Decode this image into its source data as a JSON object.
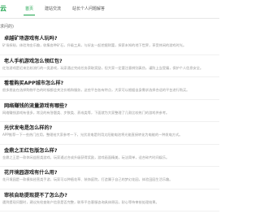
{
  "header": {
    "logo_text": "云",
    "nav": [
      "首页",
      "建站交流",
      "站长个人问题解答"
    ]
  },
  "section_title": "求问的)",
  "items": [
    {
      "title": "卓越矿场游戏有人玩吗?",
      "desc": "矿场探秘，体验淘金乐趣，收集各种矿石，升级工具，与好友一起挖掘财富，探索未知的地下世界，享受休闲的游戏时光。"
    },
    {
      "title": "老人手机游戏怎么领红包?",
      "desc": "红包游戏是近来比较流行的一类游戏，玩家通过完成任务获取奖励，但大家一定要注意辨别真伪，谨防上当受骗，保护个人信息安全。"
    },
    {
      "title": "看看购买APP城市怎么样?",
      "desc": "很多朋友在选择购物平台的时候都会关注价格和服务，这些平台各有特点，大家可以根据自身需求选择合适的平台进行购买。"
    },
    {
      "title": "网络赚钱的流量游戏有哪些?",
      "desc": "网络赚钱游戏有很多，常见的有答题类、步数类、养成类等，下面就为大家整理了几款比较热门的游戏供参考。"
    },
    {
      "title": "光伏发电是怎么样的?",
      "desc": "APP推荐一下一些热门应用，整理给大家参考一下，光伏发电是利用太阳能电池将光能直接转化为电能的一种发电方式。"
    },
    {
      "title": "金鼎之王红包版怎么样?",
      "desc": "金鼎之王是一款休闲益智类游戏，玩家通过合成升级获得奖励，游戏画面精美，玩法简单，适合碎片时间娱乐。"
    },
    {
      "title": "花开境园游戏有什么用?",
      "desc": "花开境园是一款模拟经营类手游，玩家可以种植花草、装饰庭院，打造属于自己的梦幻花园，体验田园生活乐趣。"
    },
    {
      "title": "审核自助提现提不了怎么办?",
      "desc": "遇到提现问题时，建议先检查账户信息是否完整，联系平台客服咨询具体原因，耐心等待审核处理结果。"
    }
  ]
}
